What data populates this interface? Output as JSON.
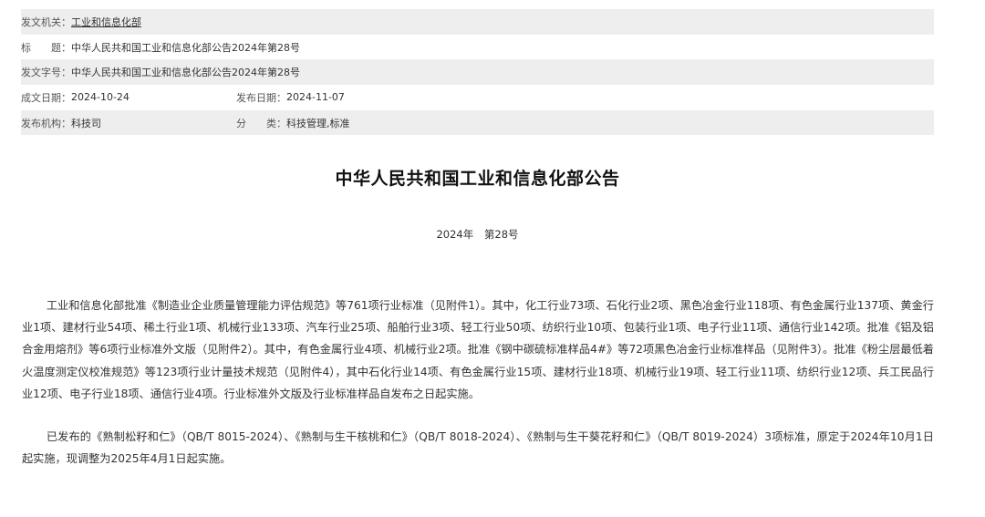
{
  "meta": {
    "issuer_label": "发文机关：",
    "issuer_value": "工业和信息化部",
    "title_label": "标　　题：",
    "title_value": "中华人民共和国工业和信息化部公告2024年第28号",
    "docno_label": "发文字号：",
    "docno_value": "中华人民共和国工业和信息化部公告2024年第28号",
    "created_label": "成文日期：",
    "created_value": "2024-10-24",
    "published_label": "发布日期：",
    "published_value": "2024-11-07",
    "agency_label": "发布机构：",
    "agency_value": "科技司",
    "category_label": "分　　类：",
    "category_value": "科技管理,标准"
  },
  "document": {
    "title": "中华人民共和国工业和信息化部公告",
    "year": "2024年",
    "number": "第28号",
    "paragraphs": [
      "工业和信息化部批准《制造业企业质量管理能力评估规范》等761项行业标准（见附件1）。其中，化工行业73项、石化行业2项、黑色冶金行业118项、有色金属行业137项、黄金行业1项、建材行业54项、稀土行业1项、机械行业133项、汽车行业25项、船舶行业3项、轻工行业50项、纺织行业10项、包装行业1项、电子行业11项、通信行业142项。批准《铝及铝合金用熔剂》等6项行业标准外文版（见附件2）。其中，有色金属行业4项、机械行业2项。批准《钢中碳硫标准样品4#》等72项黑色冶金行业标准样品（见附件3）。批准《粉尘层最低着火温度测定仪校准规范》等123项行业计量技术规范（见附件4），其中石化行业14项、有色金属行业15项、建材行业18项、机械行业19项、轻工行业11项、纺织行业12项、兵工民品行业12项、电子行业18项、通信行业4项。行业标准外文版及行业标准样品自发布之日起实施。",
      "已发布的《熟制松籽和仁》（QB/T 8015-2024）、《熟制与生干核桃和仁》（QB/T 8018-2024）、《熟制与生干葵花籽和仁》（QB/T 8019-2024）3项标准，原定于2024年10月1日起实施，现调整为2025年4月1日起实施。"
    ]
  }
}
